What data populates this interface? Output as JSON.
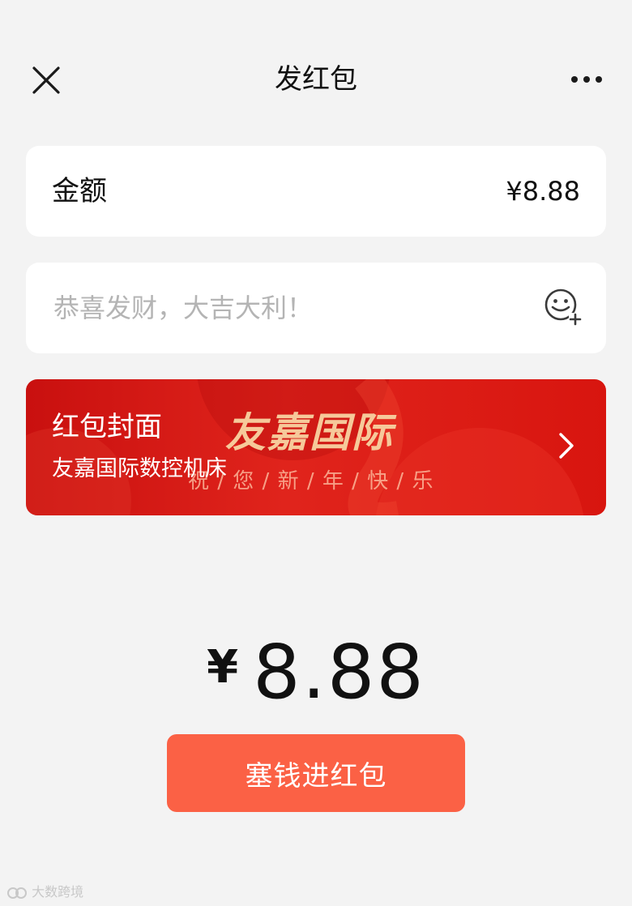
{
  "header": {
    "title": "发红包",
    "close_icon": "close-icon",
    "more_icon": "more-icon"
  },
  "amount": {
    "label": "金额",
    "value": "¥8.88"
  },
  "message": {
    "placeholder": "恭喜发财，大吉大利！",
    "value": "",
    "emoji_icon": "emoji-add-icon"
  },
  "cover": {
    "title": "红包封面",
    "subtitle": "友嘉国际数控机床",
    "brand": "友嘉国际",
    "greeting": "祝 / 您 / 新 / 年 / 快 / 乐",
    "chevron_icon": "chevron-right-icon"
  },
  "total": {
    "currency": "¥",
    "amount": "8.88"
  },
  "send_button": {
    "label": "塞钱进红包"
  },
  "watermark": {
    "text": "大数跨境"
  },
  "colors": {
    "background": "#f3f3f3",
    "button": "#fb6145",
    "cover_red": "#d8150f",
    "brand_gold": "#f6c99a"
  }
}
